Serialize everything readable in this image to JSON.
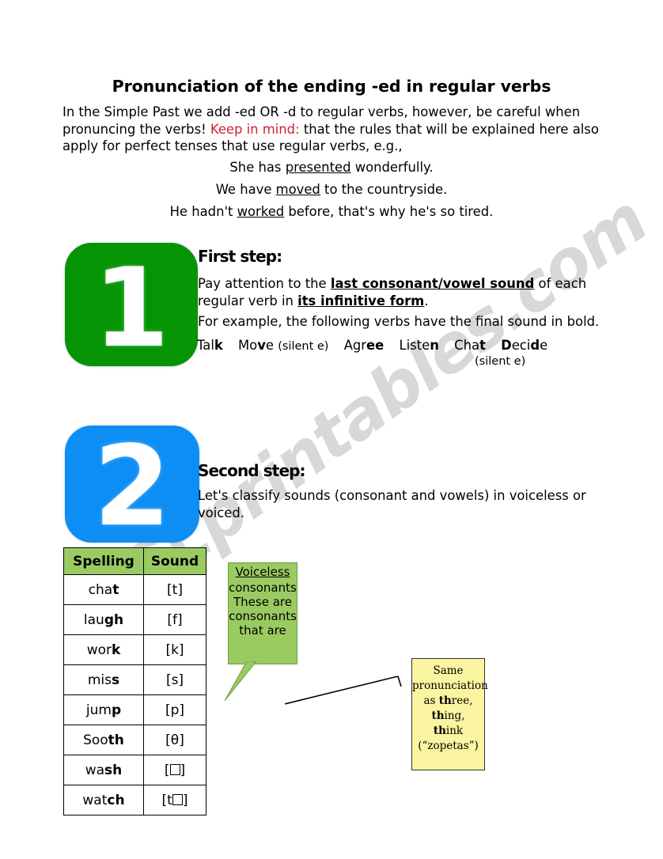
{
  "document": {
    "title": "Pronunciation of the ending -ed in regular verbs",
    "intro": {
      "part1": "In the Simple Past we add -ed OR -d to regular verbs, however, be careful when pronuncing the verbs! ",
      "highlight": "Keep in mind:",
      "part2": " that the rules that will be explained here also apply for perfect tenses that use regular verbs, e.g.,",
      "highlight_color": "#cc2233"
    },
    "examples": [
      {
        "before": "She has ",
        "underlined": "presented",
        "after": " wonderfully."
      },
      {
        "before": "We have ",
        "underlined": "moved",
        "after": " to the countryside."
      },
      {
        "before": "He hadn't ",
        "underlined": "worked",
        "after": " before, that's why he's so tired."
      }
    ]
  },
  "steps": [
    {
      "number": "1",
      "badge_color": "#049404",
      "heading": "First step:",
      "paragraph1_a": "Pay attention to the ",
      "paragraph1_bold1": "last consonant/vowel sound",
      "paragraph1_b": " of each regular verb in ",
      "paragraph1_bold2": "its infinitive form",
      "paragraph1_c": ".",
      "paragraph2": "For example, the following verbs have the final sound in bold.",
      "verbs": [
        {
          "plain": "Tal",
          "bold": "k",
          "note": ""
        },
        {
          "plain": "Mo",
          "bold": "v",
          "tail": "e",
          "note": "(silent e)"
        },
        {
          "plain": "Agr",
          "bold": "ee",
          "note": ""
        },
        {
          "plain": "Liste",
          "bold": "n",
          "note": ""
        },
        {
          "plain": "Cha",
          "bold": "t",
          "note": ""
        },
        {
          "bold_lead": "D",
          "plain": "eci",
          "bold": "d",
          "tail": "e",
          "note": ""
        }
      ],
      "silent_e_note": "(silent e)"
    },
    {
      "number": "2",
      "badge_color": "#0d8ef5",
      "heading": "Second step:",
      "paragraph1": "Let's classify sounds (consonant and vowels) in voiceless or voiced."
    }
  ],
  "table": {
    "headers": [
      "Spelling",
      "Sound"
    ],
    "header_bg": "#9acb62",
    "rows": [
      {
        "plain": "cha",
        "bold": "t",
        "sound": "[t]",
        "sound_box": ""
      },
      {
        "plain": "lau",
        "bold": "gh",
        "sound": "[f]",
        "sound_box": ""
      },
      {
        "plain": "wor",
        "bold": "k",
        "sound": "[k]",
        "sound_box": ""
      },
      {
        "plain": "mis",
        "bold": "s",
        "sound": "[s]",
        "sound_box": ""
      },
      {
        "plain": "jum",
        "bold": "p",
        "sound": "[p]",
        "sound_box": ""
      },
      {
        "plain": "Soo",
        "bold": "th",
        "sound": "[θ]",
        "sound_box": ""
      },
      {
        "plain": "wa",
        "bold": "sh",
        "sound_prefix": "[",
        "sound_box": "box",
        "sound_suffix": "]"
      },
      {
        "plain": "wat",
        "bold": "ch",
        "sound_prefix": "[t",
        "sound_box": "box",
        "sound_suffix": "]"
      }
    ]
  },
  "callouts": {
    "green": {
      "title": "Voiceless",
      "body": "consonants: These are consonants that are",
      "bg": "#9acb62"
    },
    "yellow": {
      "line1": "Same",
      "line2": "pronunciation",
      "line3_a": "as ",
      "line3_bold": "th",
      "line3_b": "ree,",
      "line4_bold": "th",
      "line4_b": "ing,",
      "line5_bold": "th",
      "line5_b": "ink",
      "line6": "(“zopetas”)",
      "bg": "#fbf4a0"
    }
  },
  "watermark": {
    "text": "ESLprintables.com"
  }
}
